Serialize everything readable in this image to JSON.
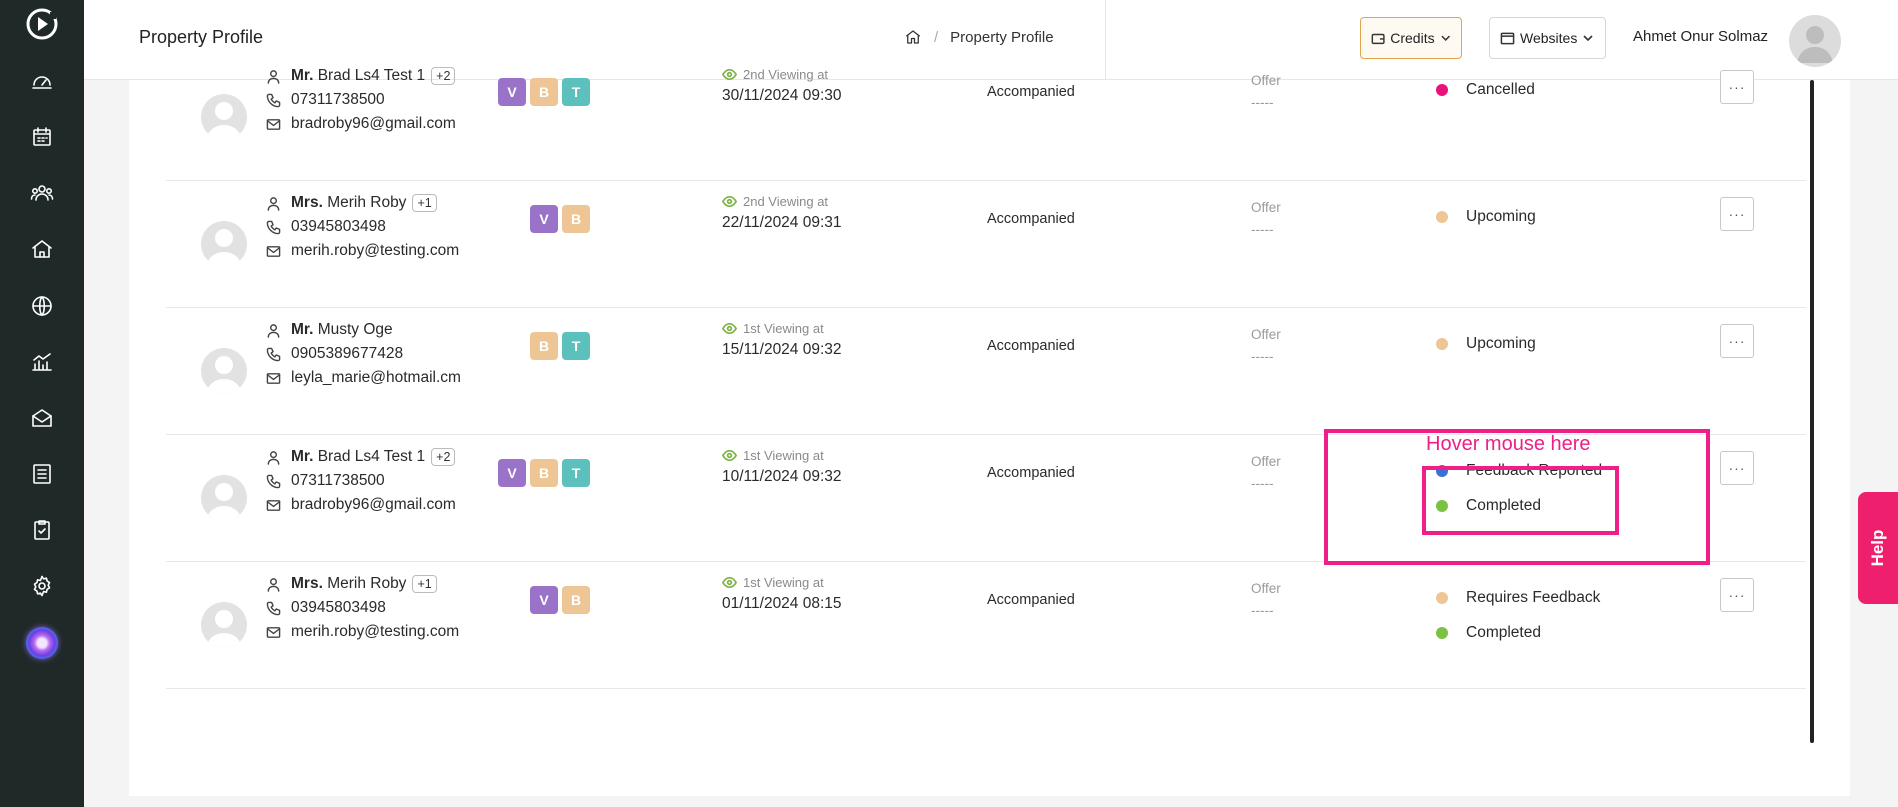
{
  "header": {
    "title": "Property Profile",
    "breadcrumb": "Property Profile",
    "credits_label": "Credits",
    "websites_label": "Websites",
    "user_name": "Ahmet Onur Solmaz"
  },
  "sidebar": {
    "items": [
      "dashboard-icon",
      "calendar-icon",
      "people-icon",
      "house-icon",
      "globe-icon",
      "chart-icon",
      "mail-icon",
      "list-icon",
      "clipboard-check-icon",
      "gear-icon"
    ]
  },
  "rows": [
    {
      "salutation": "Mr.",
      "name": "Brad Ls4 Test 1",
      "extra": "+2",
      "phone": "07311738500",
      "email": "bradroby96@gmail.com",
      "badges": [
        "V",
        "B",
        "T"
      ],
      "viewing_label": "2nd Viewing at",
      "datetime": "30/11/2024 09:30",
      "type": "Accompanied",
      "offer_label": "Offer",
      "offer_value": "-----",
      "statuses": [
        {
          "label": "Cancelled",
          "color": "#e8127d"
        }
      ]
    },
    {
      "salutation": "Mrs.",
      "name": "Merih Roby",
      "extra": "+1",
      "phone": "03945803498",
      "email": "merih.roby@testing.com",
      "badges": [
        "V",
        "B"
      ],
      "viewing_label": "2nd Viewing at",
      "datetime": "22/11/2024 09:31",
      "type": "Accompanied",
      "offer_label": "Offer",
      "offer_value": "-----",
      "statuses": [
        {
          "label": "Upcoming",
          "color": "#eec594"
        }
      ]
    },
    {
      "salutation": "Mr.",
      "name": "Musty Oge",
      "extra": "",
      "phone": "0905389677428",
      "email": "leyla_marie@hotmail.cm",
      "badges": [
        "B",
        "T"
      ],
      "viewing_label": "1st Viewing at",
      "datetime": "15/11/2024 09:32",
      "type": "Accompanied",
      "offer_label": "Offer",
      "offer_value": "-----",
      "statuses": [
        {
          "label": "Upcoming",
          "color": "#eec594"
        }
      ]
    },
    {
      "salutation": "Mr.",
      "name": "Brad Ls4 Test 1",
      "extra": "+2",
      "phone": "07311738500",
      "email": "bradroby96@gmail.com",
      "badges": [
        "V",
        "B",
        "T"
      ],
      "viewing_label": "1st Viewing at",
      "datetime": "10/11/2024 09:32",
      "type": "Accompanied",
      "offer_label": "Offer",
      "offer_value": "-----",
      "statuses": [
        {
          "label": "Feedback Reported",
          "color": "#3b6fd8"
        },
        {
          "label": "Completed",
          "color": "#7cc242"
        }
      ]
    },
    {
      "salutation": "Mrs.",
      "name": "Merih Roby",
      "extra": "+1",
      "phone": "03945803498",
      "email": "merih.roby@testing.com",
      "badges": [
        "V",
        "B"
      ],
      "viewing_label": "1st Viewing at",
      "datetime": "01/11/2024 08:15",
      "type": "Accompanied",
      "offer_label": "Offer",
      "offer_value": "-----",
      "statuses": [
        {
          "label": "Requires Feedback",
          "color": "#eec594"
        },
        {
          "label": "Completed",
          "color": "#7cc242"
        }
      ]
    }
  ],
  "annotation": {
    "text": "Hover mouse here",
    "color": "#ee1f86"
  },
  "help_label": "Help",
  "colors": {
    "sidebar": "#1f2a28",
    "accent": "#ee1f6c",
    "badge_v": "#9a72c8",
    "badge_b": "#eec594",
    "badge_t": "#5cc0bd"
  }
}
